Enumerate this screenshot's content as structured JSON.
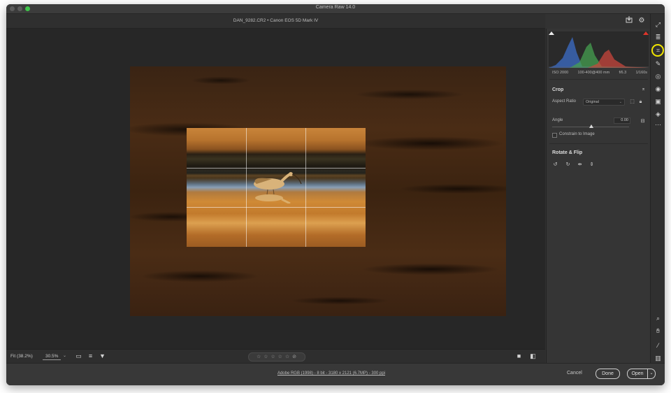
{
  "window": {
    "title": "Camera Raw 14.0"
  },
  "filebar": {
    "filename": "DAN_9282.CR2  •  Canon EOS 5D Mark IV"
  },
  "rpanel": {
    "exif": [
      "ISO 2000",
      "100-400@400 mm",
      "f/6.3",
      "1/160s"
    ],
    "crop": {
      "title": "Crop",
      "aspect_label": "Aspect Ratio",
      "aspect_value": "Original",
      "angle_label": "Angle",
      "angle_value": "0.00",
      "constrain_label": "Constrain to Image"
    },
    "rotate": {
      "title": "Rotate & Flip"
    }
  },
  "bottom": {
    "fit_label": "Fit (38.2%)",
    "zoom_value": "30.5%",
    "rating": "☆ ☆ ☆ ☆ ☆   ⊘"
  },
  "footer": {
    "info": "Adobe RGB (1998) - 8 bit - 3180 x 2121 (6.7MP) - 300 ppi",
    "cancel": "Cancel",
    "done": "Done",
    "open": "Open"
  },
  "colors": {
    "accent_highlight": "#f2e600",
    "panel_bg": "#353535",
    "canvas_bg": "#272727"
  },
  "icons": {
    "histogram_clipping": [
      "white-triangle-icon",
      "red-triangle-icon"
    ],
    "toolstrip": [
      "expand-icon",
      "edit-sliders-icon",
      "crop-icon",
      "healing-icon",
      "masking-icon",
      "red-eye-icon",
      "snapshots-icon",
      "presets-icon",
      "more-icon",
      "zoom-icon",
      "hand-icon",
      "sampler-icon",
      "grid-toggle-icon"
    ]
  }
}
